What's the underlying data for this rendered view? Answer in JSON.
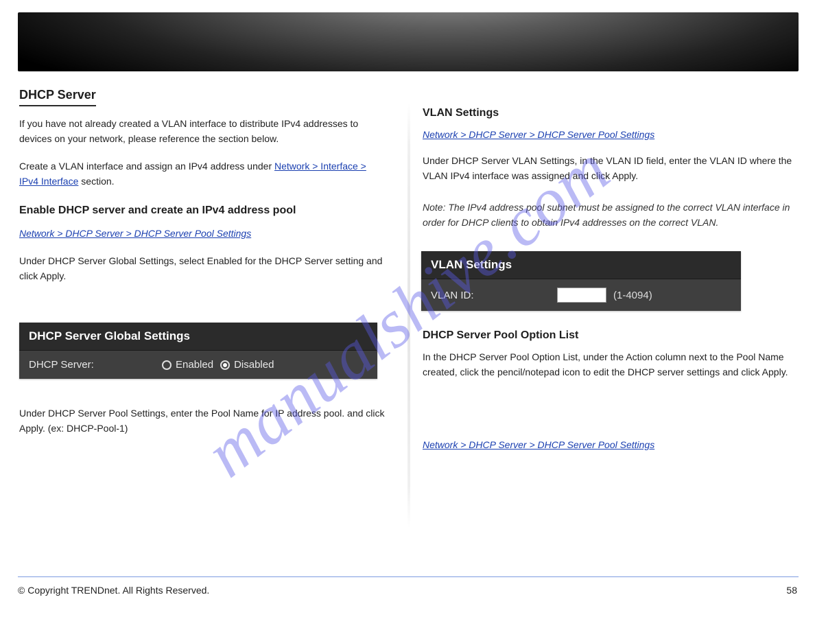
{
  "header": {
    "product_label": ""
  },
  "watermark": "manualshive.com",
  "left": {
    "heading": "DHCP Server",
    "intro": "If you have not already created a VLAN interface to distribute IPv4 addresses to devices on your network, please reference the section below.",
    "intro_link_prefix": "Create a VLAN interface and assign an IPv4 address under ",
    "intro_link": "Network > Interface > IPv4 Interface",
    "intro_link_suffix": " section.",
    "pool_heading": "Enable DHCP server and create an IPv4 address pool",
    "pool_nav": "Network > DHCP Server > DHCP Server Pool Settings",
    "pool_step1": "Under DHCP Server Global Settings, select Enabled for the DHCP Server setting and click Apply.",
    "panel_title": "DHCP Server Global Settings",
    "panel_label": "DHCP Server:",
    "panel_enabled": "Enabled",
    "panel_disabled": "Disabled",
    "pool_step2": "Under DHCP Server Pool Settings, enter the Pool Name for IP address pool. and click Apply. (ex: DHCP-Pool-1)"
  },
  "right": {
    "vlan_heading": "VLAN Settings",
    "vlan_nav": "Network > DHCP Server > DHCP Server Pool Settings",
    "vlan_step1": "Under DHCP Server VLAN Settings, in the VLAN ID field, enter the VLAN ID where the VLAN IPv4 interface was assigned and click Apply.",
    "vlan_note": "Note: The IPv4 address pool subnet must be assigned to the correct VLAN interface in order for DHCP clients to obtain IPv4 addresses on the correct VLAN.",
    "panel_title": "VLAN Settings",
    "panel_label": "VLAN ID:",
    "panel_hint": "(1-4094)",
    "input_value": "",
    "opt_heading": "DHCP Server Pool Option List",
    "opt_nav": "Network > DHCP Server > DHCP Server Pool Settings",
    "opt_body": "In the DHCP Server Pool Option List, under the Action column next to the Pool Name created, click the pencil/notepad icon to edit the DHCP server settings and click Apply."
  },
  "footer": {
    "left": "© Copyright TRENDnet. All Rights Reserved.",
    "right": "58"
  }
}
